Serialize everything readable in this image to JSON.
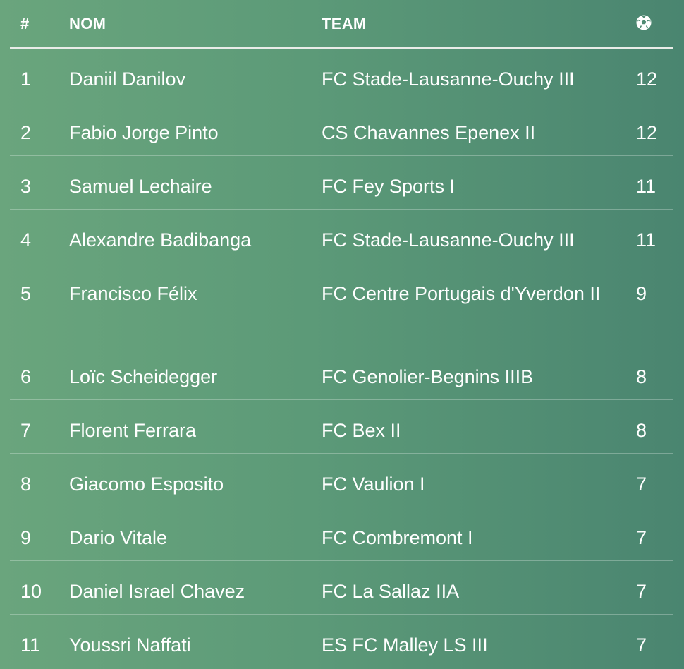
{
  "table": {
    "headers": {
      "rank": "#",
      "name": "NOM",
      "team": "TEAM",
      "goals_icon": "soccer-ball-icon"
    },
    "rows": [
      {
        "rank": "1",
        "name": "Daniil Danilov",
        "team": "FC Stade-Lausanne-Ouchy III",
        "goals": "12"
      },
      {
        "rank": "2",
        "name": "Fabio Jorge Pinto",
        "team": "CS Chavannes Epenex II",
        "goals": "12"
      },
      {
        "rank": "3",
        "name": "Samuel Lechaire",
        "team": "FC Fey Sports I",
        "goals": "11"
      },
      {
        "rank": "4",
        "name": "Alexandre Badibanga",
        "team": "FC Stade-Lausanne-Ouchy III",
        "goals": "11"
      },
      {
        "rank": "5",
        "name": "Francisco Félix",
        "team": "FC Centre Portugais d'Yverdon II",
        "goals": "9"
      },
      {
        "rank": "6",
        "name": "Loïc Scheidegger",
        "team": "FC Genolier-Begnins IIIB",
        "goals": "8"
      },
      {
        "rank": "7",
        "name": "Florent Ferrara",
        "team": "FC Bex II",
        "goals": "8"
      },
      {
        "rank": "8",
        "name": "Giacomo Esposito",
        "team": "FC Vaulion I",
        "goals": "7"
      },
      {
        "rank": "9",
        "name": "Dario Vitale",
        "team": "FC Combremont I",
        "goals": "7"
      },
      {
        "rank": "10",
        "name": "Daniel Israel Chavez",
        "team": "FC La Sallaz IIA",
        "goals": "7"
      },
      {
        "rank": "11",
        "name": "Youssri Naffati",
        "team": "ES FC Malley LS III",
        "goals": "7"
      }
    ]
  }
}
